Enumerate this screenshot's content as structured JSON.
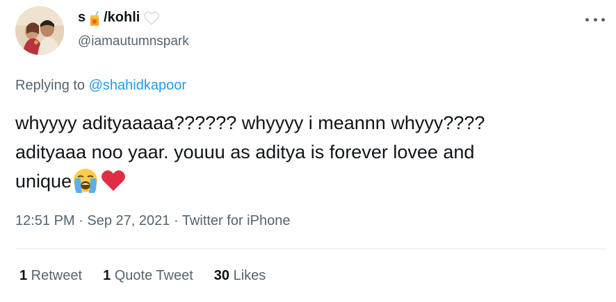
{
  "author": {
    "name_prefix": "s",
    "name_suffix": "/kohli",
    "handle": "@iamautumnspark",
    "avatar_icon": "profile-photo"
  },
  "more_icon": "more-horizontal-icon",
  "reply": {
    "prefix": "Replying to",
    "mention": "@shahidkapoor"
  },
  "tweet": {
    "line1": "whyyyy adityaaaaa?????? whyyyy i meannn whyyy????",
    "line2": "adityaaa noo yaar. youuu as aditya is forever lovee and",
    "line3": "unique",
    "emojis": [
      "loudly-crying-face-icon",
      "red-heart-icon"
    ]
  },
  "meta": {
    "time": "12:51 PM",
    "sep1": " · ",
    "date": "Sep 27, 2021",
    "sep2": " · ",
    "source": "Twitter for iPhone"
  },
  "stats": {
    "retweets_count": "1",
    "retweets_label": " Retweet",
    "quotes_count": "1",
    "quotes_label": " Quote Tweet",
    "likes_count": "30",
    "likes_label": " Likes"
  },
  "colors": {
    "text": "#0f1419",
    "secondary": "#536471",
    "link": "#1d9bf0",
    "divider": "#e5e9eb",
    "heart": "#dd2e44"
  }
}
